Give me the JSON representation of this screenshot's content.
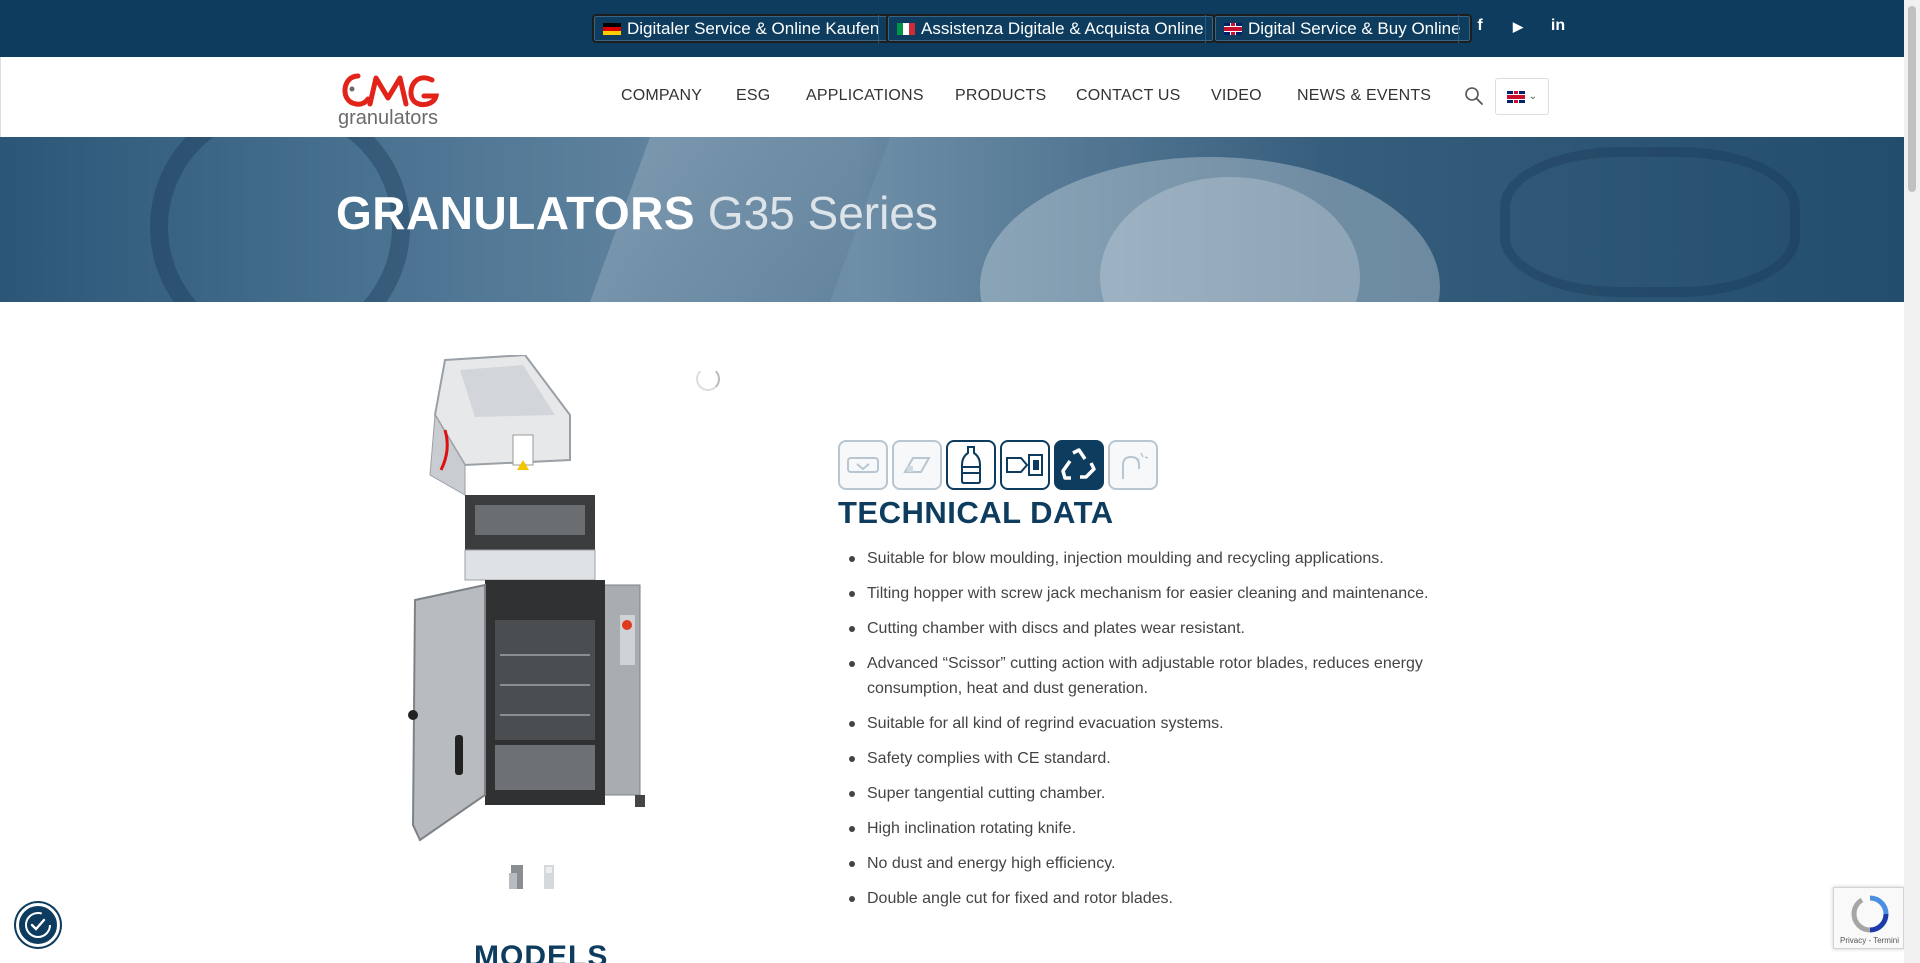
{
  "topbar": {
    "buttons": [
      {
        "label": "Digitaler Service & Online Kaufen",
        "flag": "de"
      },
      {
        "label": "Assistenza Digitale & Acquista Online",
        "flag": "it"
      },
      {
        "label": "Digital Service & Buy Online",
        "flag": "uk"
      }
    ],
    "social": {
      "facebook": "f",
      "youtube": "▶",
      "linkedin": "in"
    }
  },
  "header": {
    "logo_text": "CMG",
    "logo_sub": "granulators",
    "nav": [
      "COMPANY",
      "ESG",
      "APPLICATIONS",
      "PRODUCTS",
      "CONTACT US",
      "VIDEO",
      "NEWS & EVENTS"
    ],
    "language": "en"
  },
  "banner": {
    "title_strong": "GRANULATORS",
    "title_light": "G35 Series"
  },
  "product": {
    "technical_title": "TECHNICAL DATA",
    "models_title": "MODELS",
    "application_icons": [
      "thermoforming-icon",
      "extrusion-icon",
      "blow-moulding-icon",
      "injection-moulding-icon",
      "recycling-icon",
      "cable-icon"
    ],
    "features": [
      "Suitable for blow moulding, injection moulding and recycling applications.",
      "Tilting hopper with screw jack mechanism for easier cleaning and maintenance.",
      "Cutting chamber with discs and plates wear resistant.",
      "Advanced “Scissor” cutting action with adjustable rotor blades, reduces energy consumption, heat and dust generation.",
      "Suitable for all kind of regrind evacuation systems.",
      "Safety complies with CE standard.",
      "Super tangential cutting chamber.",
      "High inclination rotating knife.",
      "No dust and energy high efficiency.",
      "Double angle cut for fixed and rotor blades."
    ]
  },
  "recaptcha": {
    "text": "Privacy - Termini"
  },
  "colors": {
    "brand_navy": "#0d3c5e",
    "logo_red": "#e2231a",
    "logo_gray": "#6b6b6b"
  }
}
